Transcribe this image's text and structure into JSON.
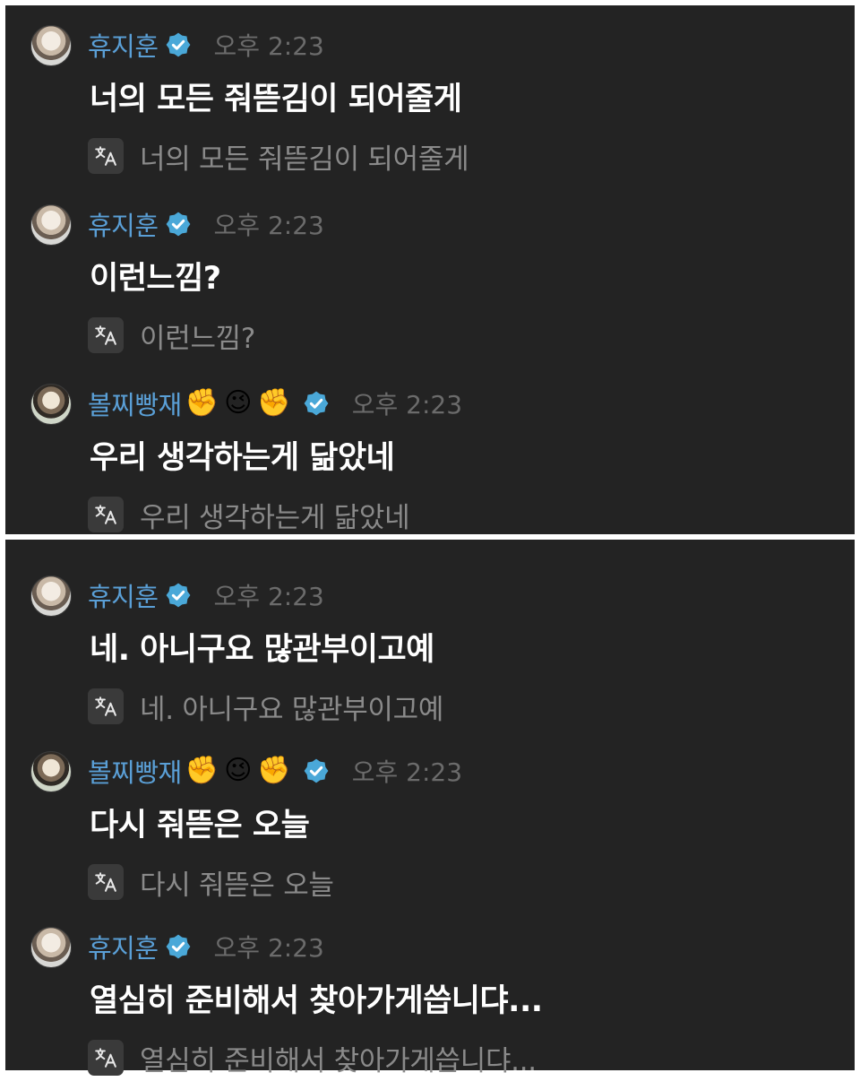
{
  "top_panel": {
    "messages": [
      {
        "username": "휴지훈",
        "emojis": [],
        "time": "오후 2:23",
        "text": "너의 모든 줘뜯김이 되어줄게",
        "translation": "너의 모든 줘뜯김이 되어줄게"
      },
      {
        "username": "휴지훈",
        "emojis": [],
        "time": "오후 2:23",
        "text": "이런느낌?",
        "translation": "이런느낌?"
      },
      {
        "username": "볼찌빵재",
        "emojis": [
          "✊",
          "😉",
          "✊"
        ],
        "time": "오후 2:23",
        "text": "우리 생각하는게 닮았네",
        "translation": "우리 생각하는게 닮았네"
      }
    ]
  },
  "bottom_panel": {
    "messages": [
      {
        "username": "휴지훈",
        "emojis": [],
        "time": "오후 2:23",
        "text": "네. 아니구요 많관부이고예",
        "translation": "네. 아니구요 많관부이고예"
      },
      {
        "username": "볼찌빵재",
        "emojis": [
          "✊",
          "😉",
          "✊"
        ],
        "time": "오후 2:23",
        "text": "다시 줘뜯은 오늘",
        "translation": "다시 줘뜯은 오늘"
      },
      {
        "username": "휴지훈",
        "emojis": [],
        "time": "오후 2:23",
        "text": "열심히 준비해서 찾아가게씁니댜...",
        "translation": "열심히 준비해서 찾아가게씁니댜..."
      }
    ]
  },
  "colors": {
    "background": "#232323",
    "username": "#5a9fd6",
    "verified": "#4aa8d8",
    "time": "#6b6b6b",
    "translation_text": "#8a8a8a"
  },
  "icons": {
    "verified": "verified-badge-icon",
    "translate": "translate-icon"
  }
}
